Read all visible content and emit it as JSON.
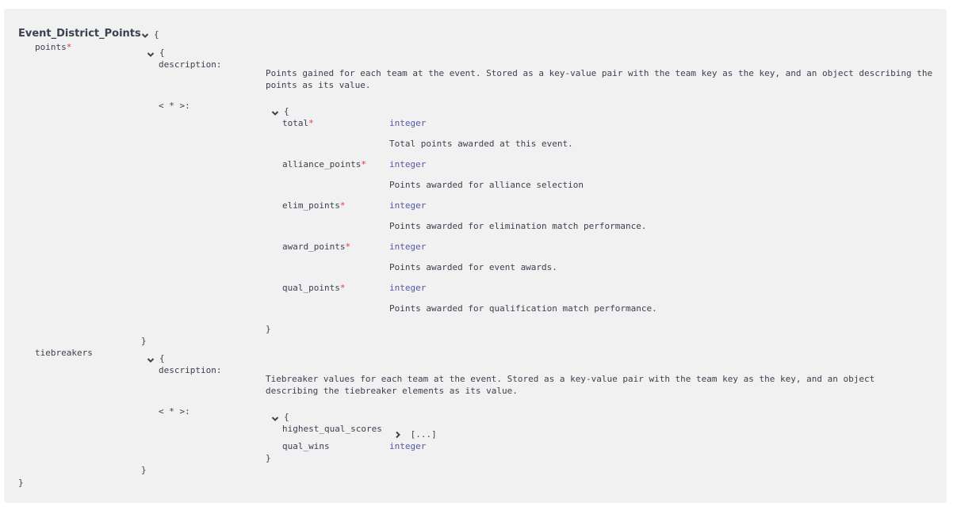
{
  "model": {
    "title": "Event_District_Points",
    "open_brace": "{",
    "close_brace": "}"
  },
  "properties": {
    "points": {
      "name": "points",
      "required_mark": "*",
      "open_brace": "{",
      "close_brace": "}",
      "description_label": "description:",
      "description": "Points gained for each team at the event. Stored as a key-value pair with the team key as the key, and an object describing the points as its value.",
      "additional_label": "< * >:",
      "inner_open": "{",
      "inner_close": "}",
      "fields": [
        {
          "name": "total",
          "required_mark": "*",
          "type": "integer",
          "description": "Total points awarded at this event."
        },
        {
          "name": "alliance_points",
          "required_mark": "*",
          "type": "integer",
          "description": "Points awarded for alliance selection"
        },
        {
          "name": "elim_points",
          "required_mark": "*",
          "type": "integer",
          "description": "Points awarded for elimination match performance."
        },
        {
          "name": "award_points",
          "required_mark": "*",
          "type": "integer",
          "description": "Points awarded for event awards."
        },
        {
          "name": "qual_points",
          "required_mark": "*",
          "type": "integer",
          "description": "Points awarded for qualification match performance."
        }
      ]
    },
    "tiebreakers": {
      "name": "tiebreakers",
      "open_brace": "{",
      "close_brace": "}",
      "description_label": "description:",
      "description": "Tiebreaker values for each team at the event. Stored as a key-value pair with the team key as the key, and an object describing the tiebreaker elements as its value.",
      "additional_label": "< * >:",
      "inner_open": "{",
      "inner_close": "}",
      "fields": [
        {
          "name": "highest_qual_scores",
          "collapsed_value": "[...]"
        },
        {
          "name": "qual_wins",
          "type": "integer"
        }
      ]
    }
  },
  "icons": {
    "expand": "chevron-down-icon",
    "collapsed": "chevron-right-icon"
  }
}
